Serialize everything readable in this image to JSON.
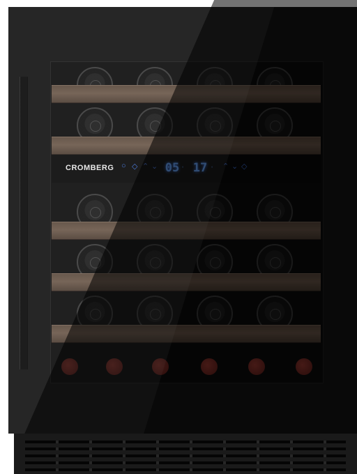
{
  "product": {
    "brand": "CROMBERG"
  },
  "display": {
    "left_digits": "05",
    "right_digits": "17",
    "indicator_color": "#5fa2ff"
  },
  "colors": {
    "cabinet": "#141414",
    "shelf_wood": "#6b584a",
    "cork": "#7a2b25"
  }
}
